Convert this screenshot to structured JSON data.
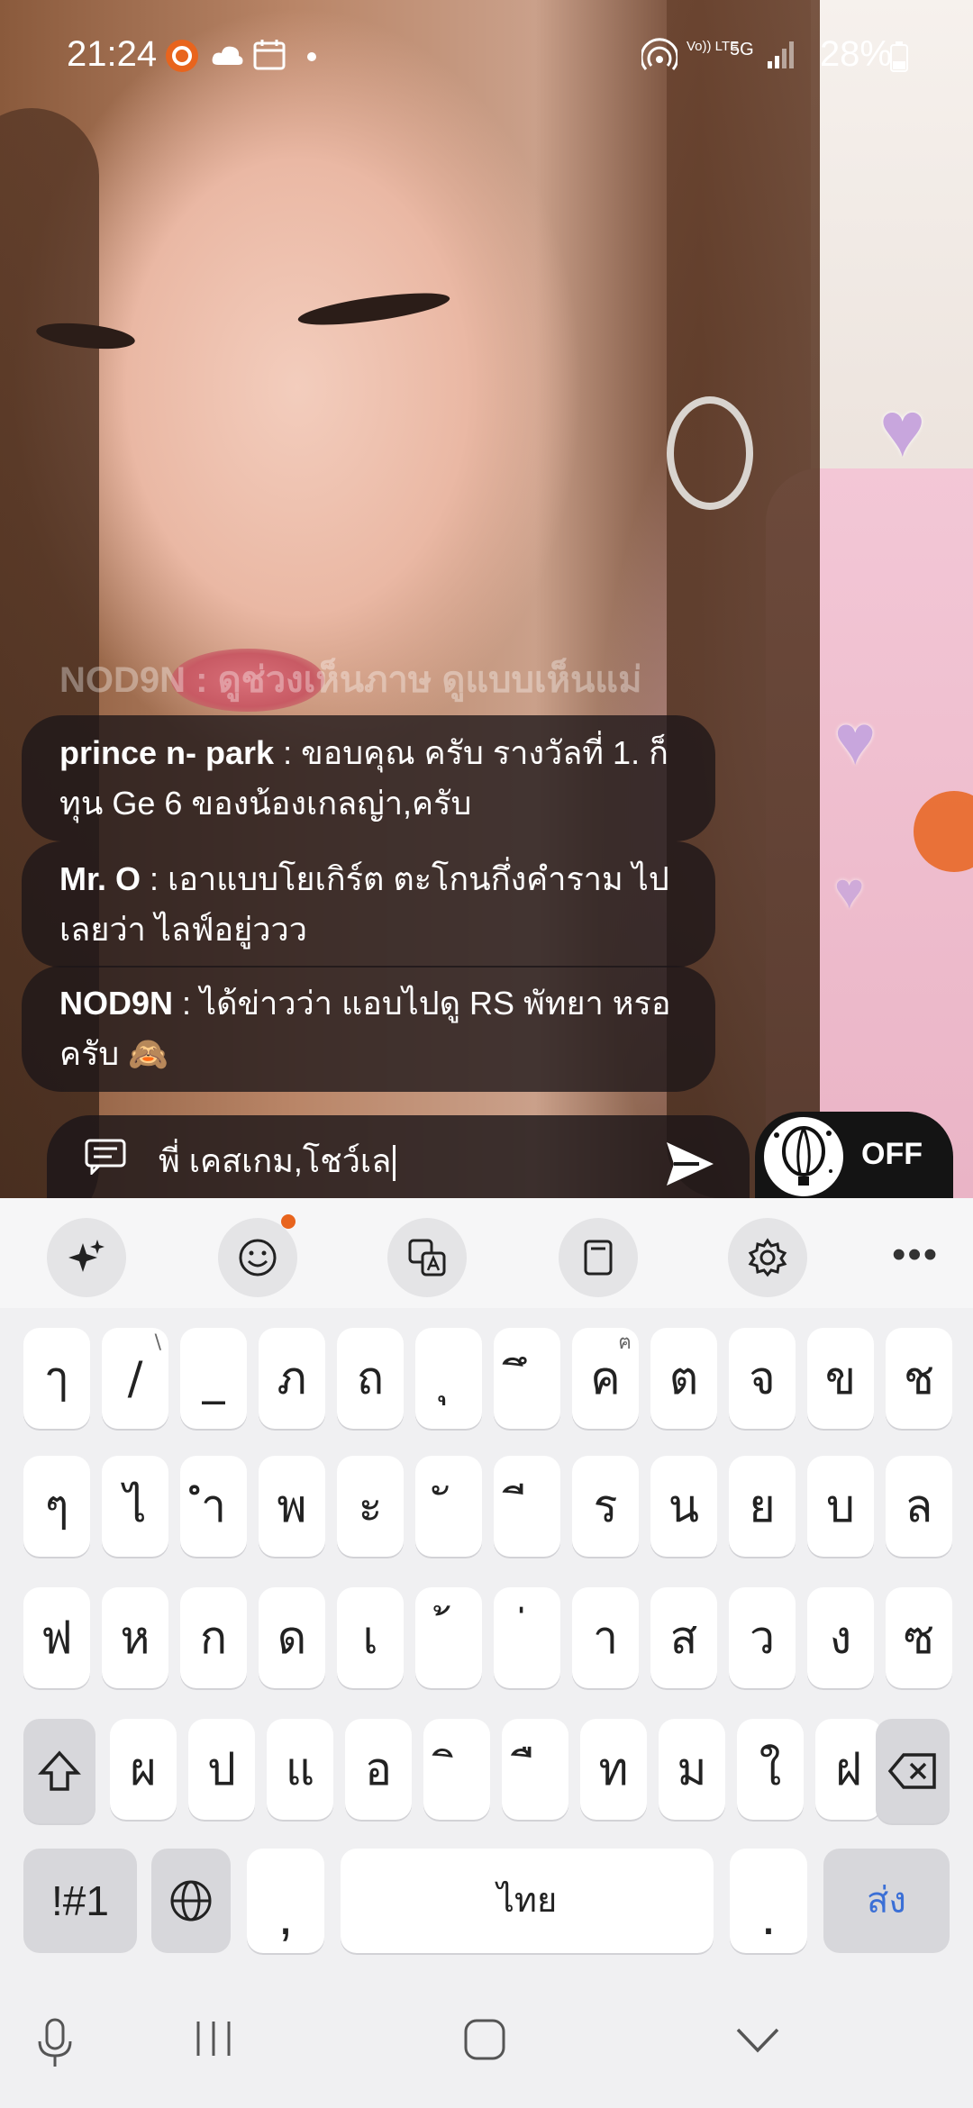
{
  "status_bar": {
    "time": "21:24",
    "battery": "28%",
    "network": "5G",
    "volte": "Vo)) LTE"
  },
  "chat": {
    "faded_message": "NOD9N : ดูช่วงเห็นภาษ ดูแบบเห็นแม่",
    "messages": [
      {
        "user": "prince n- park",
        "text": " : ขอบคุณ ครับ รางวัลที่ 1. ก็ ทุน Ge 6 ของน้องเกลญ่า,ครับ"
      },
      {
        "user": "Mr. O",
        "text": " : เอาแบบโยเกิร์ต ตะโกนกึ่งคำราม ไปเลยว่า ไลฟ์อยู่ววว"
      },
      {
        "user": "NOD9N",
        "text": " : ได้ข่าวว่า แอบไปดู RS พัทยา หรอครับ 🙈"
      }
    ]
  },
  "input": {
    "value": "พี่ เคสเกม,โชว์เล"
  },
  "balloon_toggle": {
    "label": "OFF"
  },
  "keyboard": {
    "rows": [
      [
        {
          "k": "ๅ"
        },
        {
          "k": "/",
          "h": "\\"
        },
        {
          "k": "_"
        },
        {
          "k": "ภ"
        },
        {
          "k": "ถ"
        },
        {
          "k": "ุ"
        },
        {
          "k": "ึ"
        },
        {
          "k": "ค",
          "h": "ฅ"
        },
        {
          "k": "ต"
        },
        {
          "k": "จ"
        },
        {
          "k": "ข"
        },
        {
          "k": "ช"
        }
      ],
      [
        {
          "k": "ๆ"
        },
        {
          "k": "ไ"
        },
        {
          "k": "ำ"
        },
        {
          "k": "พ"
        },
        {
          "k": "ะ"
        },
        {
          "k": "ั"
        },
        {
          "k": "ี"
        },
        {
          "k": "ร"
        },
        {
          "k": "น"
        },
        {
          "k": "ย"
        },
        {
          "k": "บ"
        },
        {
          "k": "ล"
        }
      ],
      [
        {
          "k": "ฟ"
        },
        {
          "k": "ห"
        },
        {
          "k": "ก"
        },
        {
          "k": "ด"
        },
        {
          "k": "เ"
        },
        {
          "k": "้"
        },
        {
          "k": "่"
        },
        {
          "k": "า"
        },
        {
          "k": "ส"
        },
        {
          "k": "ว"
        },
        {
          "k": "ง"
        },
        {
          "k": "ซ"
        }
      ],
      [
        {
          "k": "ผ"
        },
        {
          "k": "ป"
        },
        {
          "k": "แ"
        },
        {
          "k": "อ"
        },
        {
          "k": "ิ"
        },
        {
          "k": "ื"
        },
        {
          "k": "ท"
        },
        {
          "k": "ม"
        },
        {
          "k": "ใ"
        },
        {
          "k": "ฝ"
        }
      ]
    ],
    "symbols_key": "!#1",
    "comma_key": ",",
    "space_label": "ไทย",
    "period_key": ".",
    "send_label": "ส่ง",
    "send_color": "#3b6fd6"
  }
}
